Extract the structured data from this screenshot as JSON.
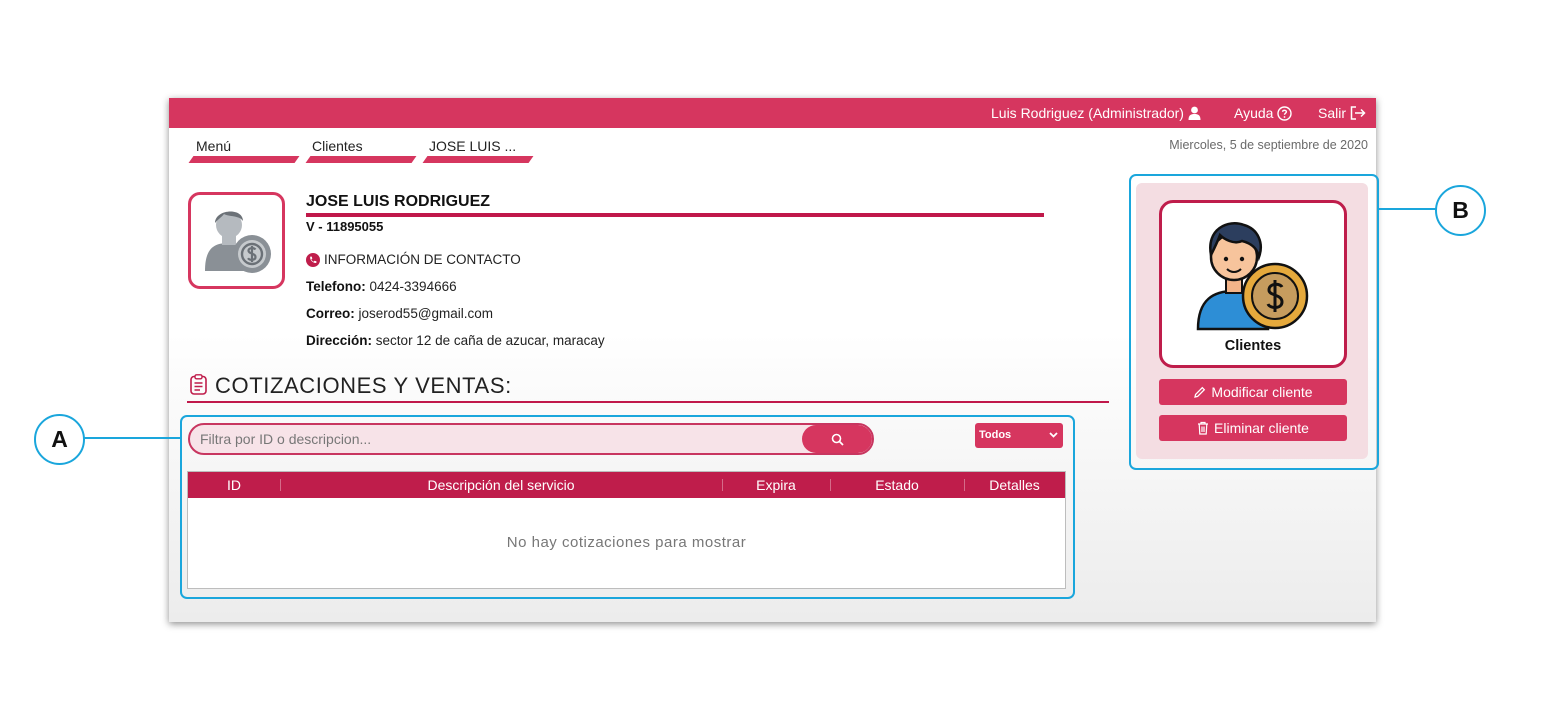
{
  "topbar": {
    "user": "Luis Rodriguez (Administrador)",
    "help": "Ayuda",
    "logout": "Salir",
    "icons": [
      "user-icon",
      "question-circle-icon",
      "logout-arrow-icon"
    ]
  },
  "breadcrumb": [
    "Menú",
    "Clientes",
    "JOSE LUIS ..."
  ],
  "date": "Miercoles, 5 de septiembre de 2020",
  "client": {
    "name": "JOSE LUIS RODRIGUEZ",
    "id_doc": "V - 11895055",
    "contact_heading": "INFORMACIÓN DE CONTACTO",
    "phone_label": "Telefono:",
    "phone": "0424-3394666",
    "email_label": "Correo:",
    "email": "joserod55@gmail.com",
    "address_label": "Dirección:",
    "address": "sector 12 de caña de azucar, maracay"
  },
  "section": {
    "title": "COTIZACIONES Y VENTAS:",
    "search_placeholder": "Filtra por ID o descripcion...",
    "filter_selected": "Todos",
    "columns": [
      "ID",
      "Descripción del servicio",
      "Expira",
      "Estado",
      "Detalles"
    ],
    "empty_message": "No hay cotizaciones para mostrar"
  },
  "sidebar": {
    "card_label": "Clientes",
    "modify_button": "Modificar cliente",
    "delete_button": "Eliminar cliente"
  },
  "annotations": {
    "a": "A",
    "b": "B"
  },
  "colors": {
    "brand": "#d6365f",
    "brand_dark": "#bf1d4b",
    "callout": "#1aa6dc",
    "card_bg": "#f4dde2"
  }
}
